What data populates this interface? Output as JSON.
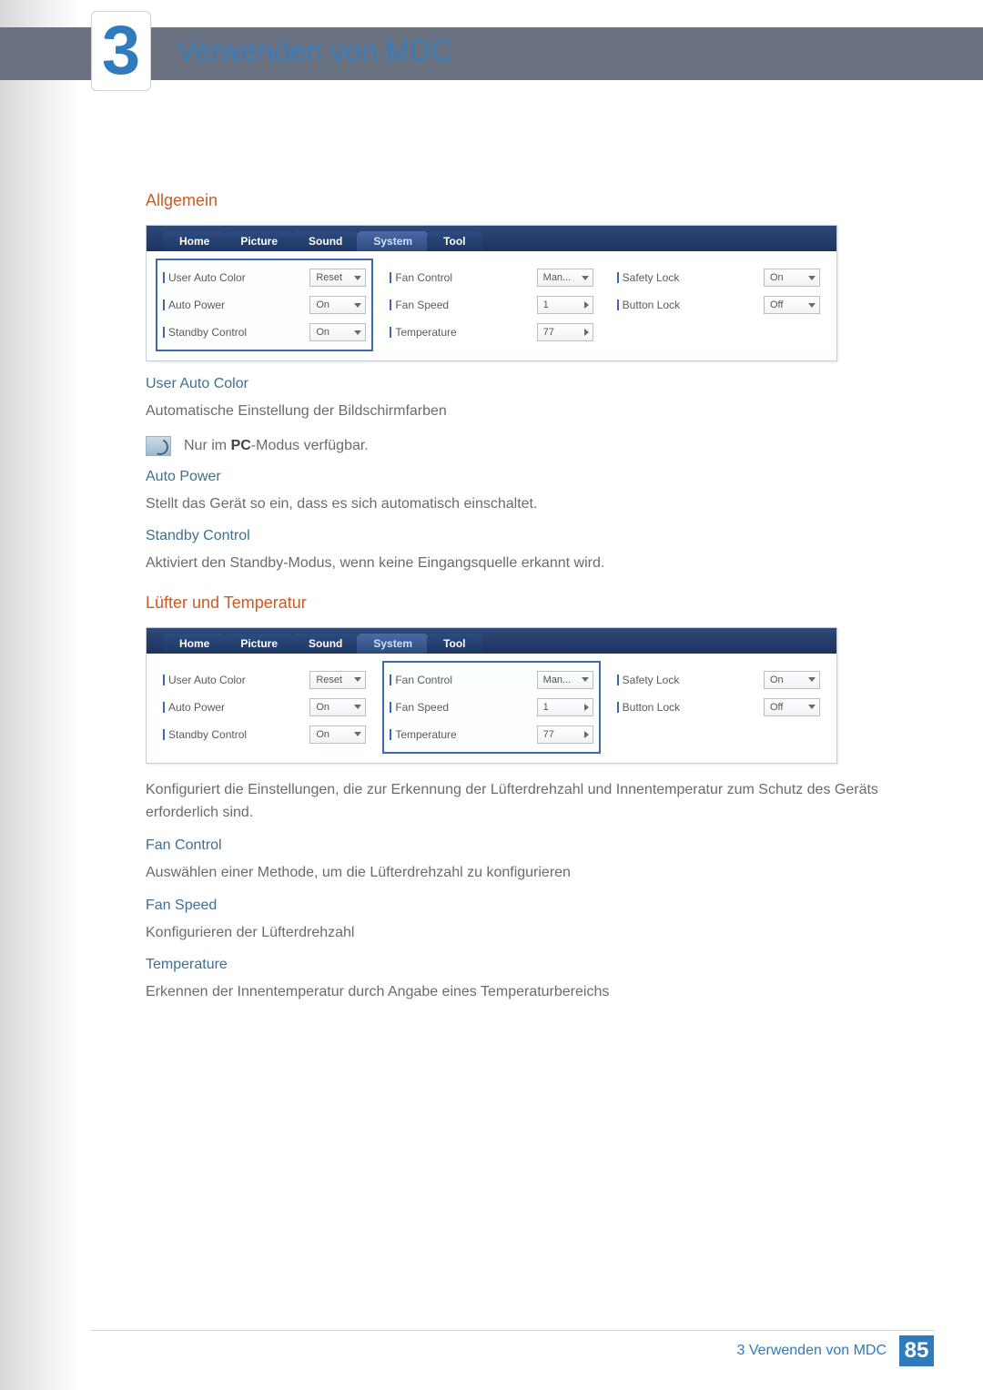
{
  "chapter": {
    "number": "3",
    "title": "Verwenden von MDC"
  },
  "sections": {
    "allgemein": "Allgemein",
    "luefter": "Lüfter und Temperatur"
  },
  "tabs": {
    "home": "Home",
    "picture": "Picture",
    "sound": "Sound",
    "system": "System",
    "tool": "Tool"
  },
  "fields": {
    "user_auto_color": "User Auto Color",
    "auto_power": "Auto Power",
    "standby_control": "Standby Control",
    "fan_control": "Fan Control",
    "fan_speed": "Fan Speed",
    "temperature": "Temperature",
    "safety_lock": "Safety Lock",
    "button_lock": "Button Lock"
  },
  "values": {
    "reset": "Reset",
    "on": "On",
    "off": "Off",
    "man": "Man...",
    "one": "1",
    "seventyseven": "77"
  },
  "desc": {
    "uac_title": "User Auto Color",
    "uac_body": "Automatische Einstellung der Bildschirmfarben",
    "uac_note_pre": "Nur im ",
    "uac_note_bold": "PC",
    "uac_note_post": "-Modus verfügbar.",
    "ap_title": "Auto Power",
    "ap_body": "Stellt das Gerät so ein, dass es sich automatisch einschaltet.",
    "sc_title": "Standby Control",
    "sc_body": "Aktiviert den Standby-Modus, wenn keine Eingangsquelle erkannt wird.",
    "luefter_body": "Konfiguriert die Einstellungen, die zur Erkennung der Lüfterdrehzahl und Innentemperatur zum Schutz des Geräts erforderlich sind.",
    "fc_title": "Fan Control",
    "fc_body": "Auswählen einer Methode, um die Lüfterdrehzahl zu konfigurieren",
    "fs_title": "Fan Speed",
    "fs_body": "Konfigurieren der Lüfterdrehzahl",
    "tmp_title": "Temperature",
    "tmp_body": "Erkennen der Innentemperatur durch Angabe eines Temperaturbereichs"
  },
  "footer": {
    "text": "3 Verwenden von MDC",
    "page": "85"
  }
}
